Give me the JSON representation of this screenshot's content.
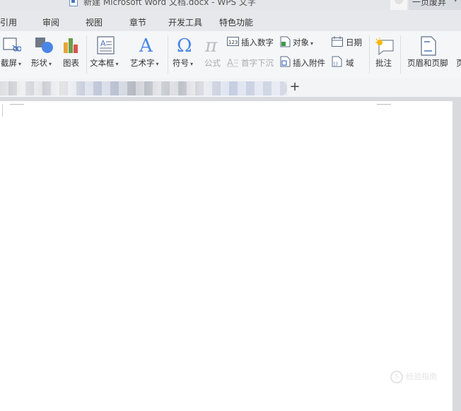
{
  "window": {
    "title": "新建 Microsoft Word 文档.docx - WPS 文字",
    "user_name": "一页废弃"
  },
  "menu": {
    "items": [
      "引用",
      "审阅",
      "视图",
      "章节",
      "开发工具",
      "特色功能"
    ]
  },
  "ribbon": {
    "screenshot": "截屏",
    "shapes": "形状",
    "chart": "图表",
    "textbox": "文本框",
    "wordart": "艺术字",
    "symbol": "符号",
    "formula": "公式",
    "insert_number": "插入数字",
    "drop_cap": "首字下沉",
    "object": "对象",
    "insert_attachment": "插入附件",
    "date": "日期",
    "field": "域",
    "comment": "批注",
    "header_footer": "页眉和页脚",
    "overflow": "页"
  },
  "tabs": {
    "add": "+"
  },
  "watermark": {
    "text": "经验指南"
  },
  "colors": {
    "accent": "#4a74c1",
    "page": "#ffffff",
    "workspace": "#d9dadd"
  }
}
